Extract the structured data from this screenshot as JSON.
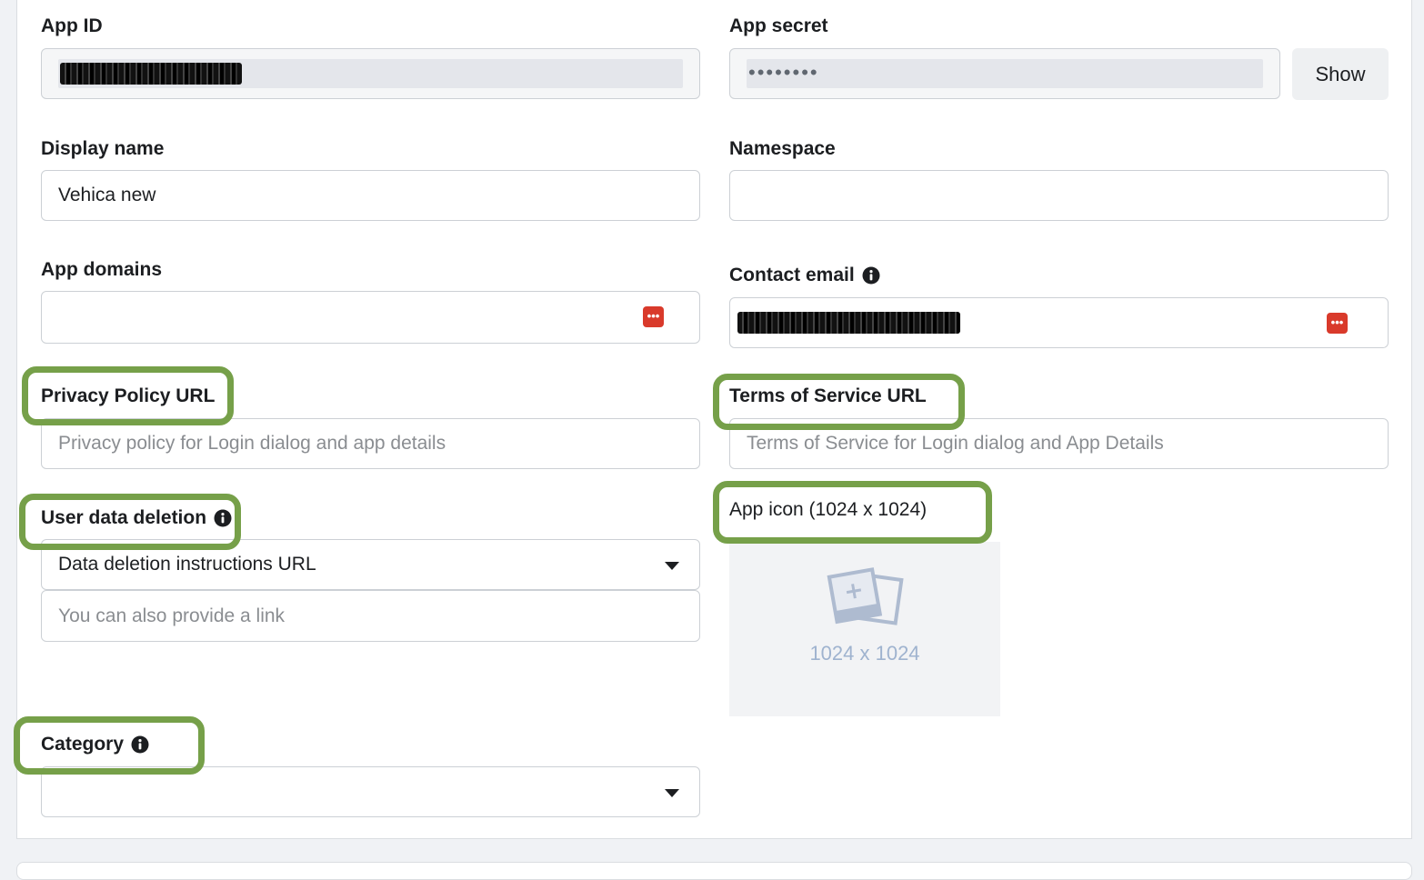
{
  "app_id": {
    "label": "App ID",
    "value_redacted": true
  },
  "app_secret": {
    "label": "App secret",
    "masked_value": "••••••••",
    "show_button": "Show"
  },
  "display_name": {
    "label": "Display name",
    "value": "Vehica new"
  },
  "namespace": {
    "label": "Namespace",
    "value": ""
  },
  "app_domains": {
    "label": "App domains",
    "value": ""
  },
  "contact_email": {
    "label": "Contact email",
    "value_redacted": true
  },
  "privacy_policy": {
    "label": "Privacy Policy URL",
    "placeholder": "Privacy policy for Login dialog and app details"
  },
  "terms_of_service": {
    "label": "Terms of Service URL",
    "placeholder": "Terms of Service for Login dialog and App Details"
  },
  "user_data_deletion": {
    "label": "User data deletion",
    "selected_option": "Data deletion instructions URL",
    "link_placeholder": "You can also provide a link"
  },
  "app_icon": {
    "label": "App icon (1024 x 1024)",
    "size_hint": "1024 x 1024"
  },
  "category": {
    "label": "Category",
    "selected_option": ""
  },
  "icons": {
    "info": "info-circle-icon",
    "password_manager": "password-manager-icon",
    "dropdown": "caret-down-icon",
    "image_upload": "add-image-icon"
  },
  "colors": {
    "highlight": "#76a049",
    "password_manager": "#d93a2b",
    "upload_text": "#9fb3cf"
  }
}
